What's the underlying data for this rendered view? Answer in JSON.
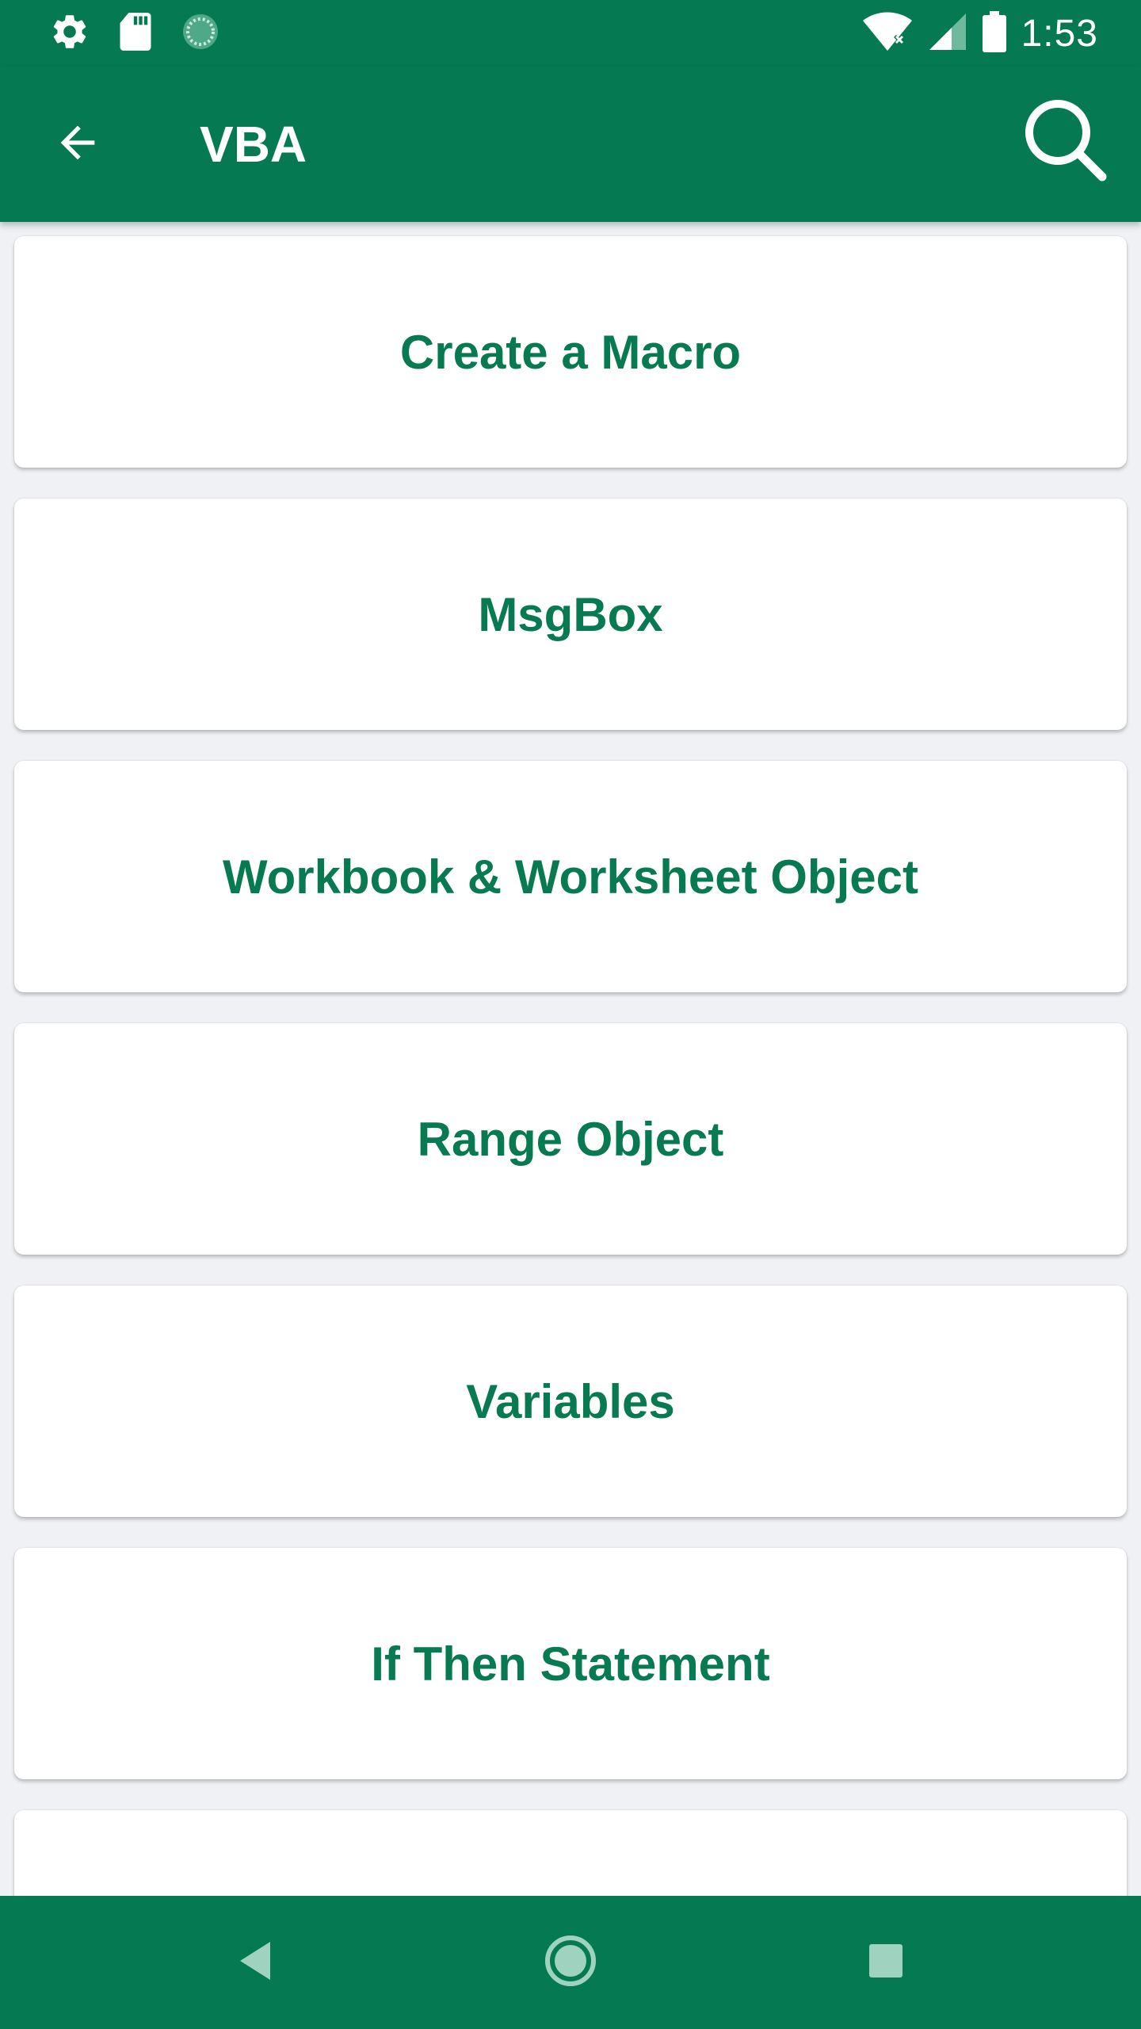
{
  "status_bar": {
    "time": "1:53",
    "icons": [
      "settings-icon",
      "sd-card-icon",
      "sync-icon",
      "wifi-icon",
      "signal-icon",
      "battery-icon"
    ]
  },
  "app_bar": {
    "title": "VBA",
    "back_icon": "arrow-back-icon",
    "search_icon": "search-icon"
  },
  "topics": [
    {
      "label": "Create a Macro"
    },
    {
      "label": "MsgBox"
    },
    {
      "label": "Workbook & Worksheet Object"
    },
    {
      "label": "Range Object"
    },
    {
      "label": "Variables"
    },
    {
      "label": "If Then Statement"
    },
    {
      "label": ""
    }
  ],
  "nav_bar": {
    "icons": [
      "nav-back-icon",
      "nav-home-icon",
      "nav-recents-icon"
    ]
  },
  "colors": {
    "primary": "#057a52",
    "text_accent": "#087a52",
    "background": "#eff1f4",
    "card": "#ffffff"
  }
}
